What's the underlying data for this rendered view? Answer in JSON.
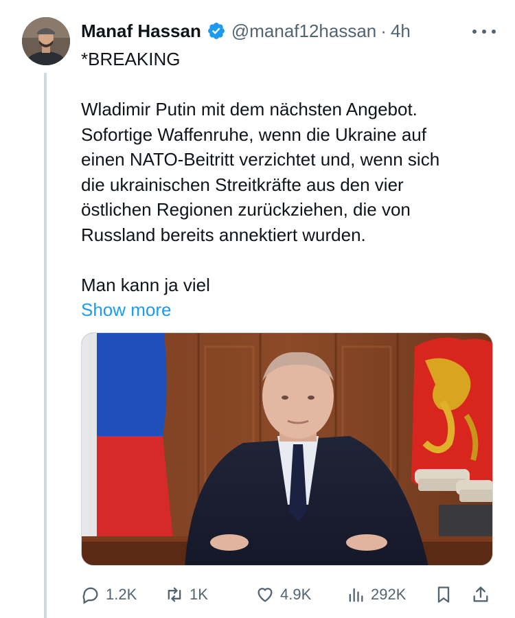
{
  "tweet": {
    "author_name": "Manaf Hassan",
    "handle": "@manaf12hassan",
    "separator": "·",
    "time": "4h",
    "lines": [
      "*BREAKING",
      "",
      "Wladimir Putin mit dem nächsten Angebot.",
      "Sofortige Waffenruhe, wenn die Ukraine auf",
      "einen NATO-Beitritt verzichtet und, wenn sich",
      "die ukrainischen Streitkräfte aus den vier",
      "östlichen Regionen zurückziehen, die von",
      "Russland bereits annektiert wurden.",
      "",
      "Man kann ja viel"
    ],
    "show_more": "Show more"
  },
  "actions": {
    "replies": "1.2K",
    "reposts": "1K",
    "likes": "4.9K",
    "views": "292K"
  },
  "icons": {
    "verified": "verified-badge-icon",
    "more": "more-icon",
    "reply": "reply-icon",
    "repost": "repost-icon",
    "like": "heart-icon",
    "views": "views-icon",
    "bookmark": "bookmark-icon",
    "share": "share-icon"
  },
  "colors": {
    "accent": "#1d9bf0",
    "secondary_text": "#536471",
    "primary_text": "#0f1419"
  }
}
